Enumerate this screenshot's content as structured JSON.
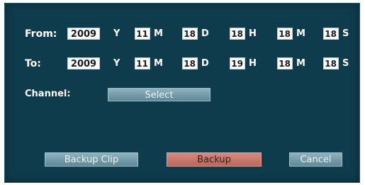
{
  "from": {
    "label": "From:",
    "year": "2009",
    "year_unit": "Y",
    "month": "11",
    "month_unit": "M",
    "day": "18",
    "day_unit": "D",
    "hour": "18",
    "hour_unit": "H",
    "minute": "18",
    "minute_unit": "M",
    "second": "18",
    "second_unit": "S"
  },
  "to": {
    "label": "To:",
    "year": "2009",
    "year_unit": "Y",
    "month": "11",
    "month_unit": "M",
    "day": "18",
    "day_unit": "D",
    "hour": "19",
    "hour_unit": "H",
    "minute": "18",
    "minute_unit": "M",
    "second": "18",
    "second_unit": "S"
  },
  "channel": {
    "label": "Channel:",
    "select_label": "Select"
  },
  "buttons": {
    "backup_clip": "Backup  Clip",
    "backup": "Backup",
    "cancel": "Cancel"
  },
  "colors": {
    "background": "#0f3c4d",
    "button_gray": "#6f97a6",
    "button_red": "#c77a6d",
    "text": "#ffffff"
  }
}
